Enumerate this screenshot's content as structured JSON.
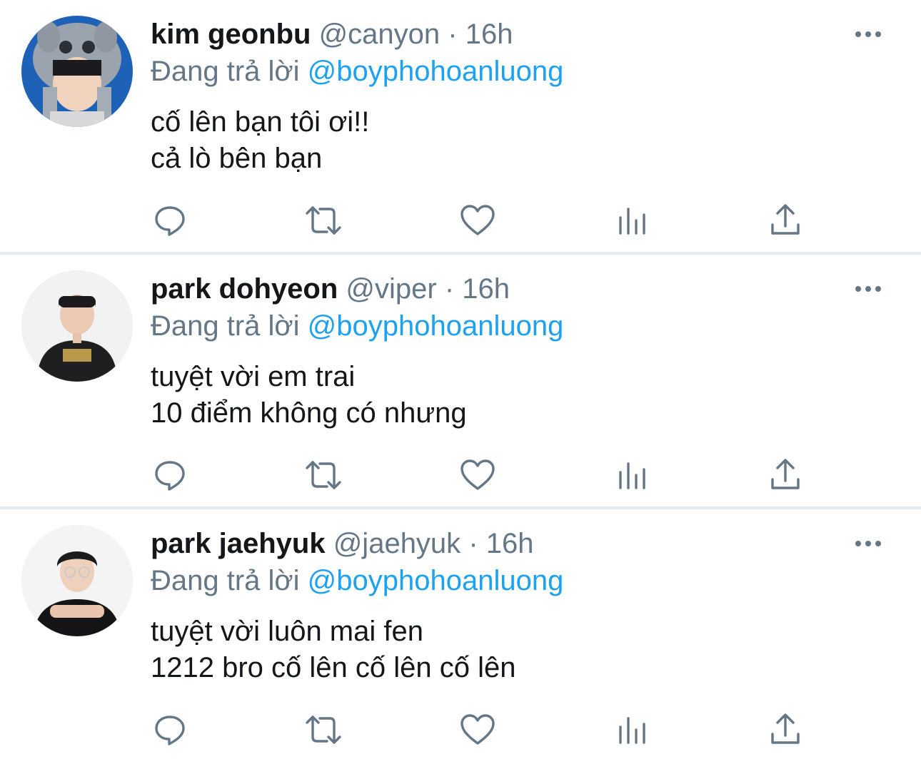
{
  "tweets": [
    {
      "name": "kim geonbu",
      "handle": "@canyon",
      "separator": "·",
      "time": "16h",
      "reply_prefix": "Đang trả lời",
      "reply_to": "@boyphohoanluong",
      "lines": [
        "cố lên bạn tôi ơi!!",
        "cả lò bên bạn"
      ],
      "avatar_icon": "avatar-photo-hat"
    },
    {
      "name": "park dohyeon",
      "handle": "@viper",
      "separator": "·",
      "time": "16h",
      "reply_prefix": "Đang trả lời",
      "reply_to": "@boyphohoanluong",
      "lines": [
        "tuyệt vời em trai",
        "10 điểm không có nhưng"
      ],
      "avatar_icon": "avatar-photo-jacket"
    },
    {
      "name": "park jaehyuk",
      "handle": "@jaehyuk",
      "separator": "·",
      "time": "16h",
      "reply_prefix": "Đang trả lời",
      "reply_to": "@boyphohoanluong",
      "lines": [
        "tuyệt vời luôn mai fen",
        "1212 bro cố lên cố lên cố lên"
      ],
      "avatar_icon": "avatar-photo-glasses"
    }
  ],
  "action_icons": [
    "reply-icon",
    "retweet-icon",
    "like-icon",
    "analytics-icon",
    "share-icon"
  ],
  "colors": {
    "text": "#14171a",
    "secondary": "#657786",
    "link": "#1da1f2",
    "divider": "#e6ecf0"
  }
}
